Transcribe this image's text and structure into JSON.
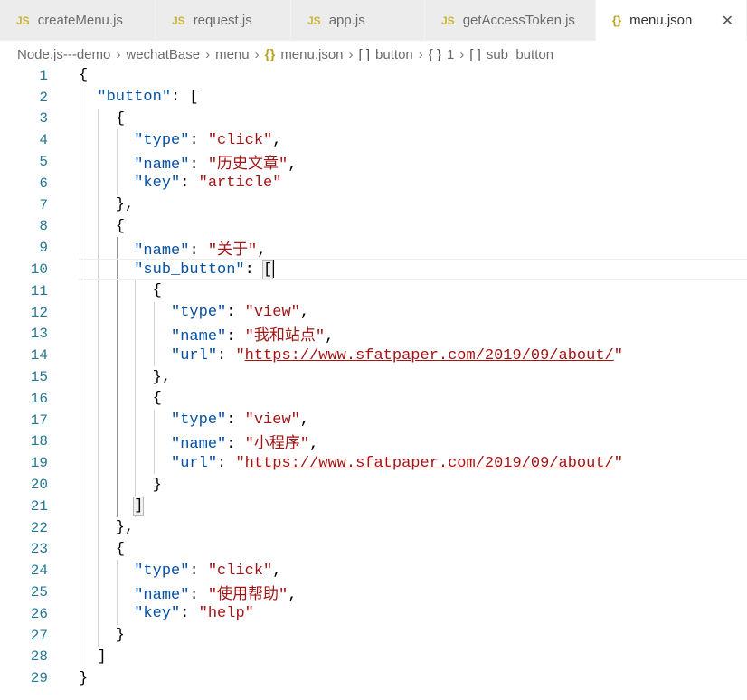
{
  "tabs": [
    {
      "icon": "JS",
      "label": "createMenu.js",
      "active": false,
      "width": 172
    },
    {
      "icon": "JS",
      "label": "request.js",
      "active": false,
      "width": 150
    },
    {
      "icon": "JS",
      "label": "app.js",
      "active": false,
      "width": 148
    },
    {
      "icon": "JS",
      "label": "getAccessToken.js",
      "active": false,
      "width": 189
    },
    {
      "icon": "{}",
      "label": "menu.json",
      "active": true,
      "width": 167
    }
  ],
  "breadcrumb": {
    "items": [
      "Node.js---demo",
      "wechatBase",
      "menu",
      "menu.json",
      "button",
      "1",
      "sub_button"
    ],
    "icons": [
      "",
      "",
      "",
      "{}",
      "[ ]",
      "{ }",
      "[ ]"
    ]
  },
  "editor": {
    "current_line": 10,
    "lines": [
      [
        [
          "p",
          "{"
        ]
      ],
      [
        [
          "p",
          "  "
        ],
        [
          "k",
          "\"button\""
        ],
        [
          "p",
          ": ["
        ]
      ],
      [
        [
          "p",
          "    {"
        ]
      ],
      [
        [
          "p",
          "      "
        ],
        [
          "k",
          "\"type\""
        ],
        [
          "p",
          ": "
        ],
        [
          "s",
          "\"click\""
        ],
        [
          "p",
          ","
        ]
      ],
      [
        [
          "p",
          "      "
        ],
        [
          "k",
          "\"name\""
        ],
        [
          "p",
          ": "
        ],
        [
          "s",
          "\"历史文章\""
        ],
        [
          "p",
          ","
        ]
      ],
      [
        [
          "p",
          "      "
        ],
        [
          "k",
          "\"key\""
        ],
        [
          "p",
          ": "
        ],
        [
          "s",
          "\"article\""
        ]
      ],
      [
        [
          "p",
          "    },"
        ]
      ],
      [
        [
          "p",
          "    {"
        ]
      ],
      [
        [
          "p",
          "      "
        ],
        [
          "k",
          "\"name\""
        ],
        [
          "p",
          ": "
        ],
        [
          "s",
          "\"关于\""
        ],
        [
          "p",
          ","
        ]
      ],
      [
        [
          "p",
          "      "
        ],
        [
          "k",
          "\"sub_button\""
        ],
        [
          "p",
          ": "
        ],
        [
          "b",
          "["
        ]
      ],
      [
        [
          "p",
          "        {"
        ]
      ],
      [
        [
          "p",
          "          "
        ],
        [
          "k",
          "\"type\""
        ],
        [
          "p",
          ": "
        ],
        [
          "s",
          "\"view\""
        ],
        [
          "p",
          ","
        ]
      ],
      [
        [
          "p",
          "          "
        ],
        [
          "k",
          "\"name\""
        ],
        [
          "p",
          ": "
        ],
        [
          "s",
          "\"我和站点\""
        ],
        [
          "p",
          ","
        ]
      ],
      [
        [
          "p",
          "          "
        ],
        [
          "k",
          "\"url\""
        ],
        [
          "p",
          ": "
        ],
        [
          "s",
          "\""
        ],
        [
          "u",
          "https://www.sfatpaper.com/2019/09/about/"
        ],
        [
          "s",
          "\""
        ]
      ],
      [
        [
          "p",
          "        },"
        ]
      ],
      [
        [
          "p",
          "        {"
        ]
      ],
      [
        [
          "p",
          "          "
        ],
        [
          "k",
          "\"type\""
        ],
        [
          "p",
          ": "
        ],
        [
          "s",
          "\"view\""
        ],
        [
          "p",
          ","
        ]
      ],
      [
        [
          "p",
          "          "
        ],
        [
          "k",
          "\"name\""
        ],
        [
          "p",
          ": "
        ],
        [
          "s",
          "\"小程序\""
        ],
        [
          "p",
          ","
        ]
      ],
      [
        [
          "p",
          "          "
        ],
        [
          "k",
          "\"url\""
        ],
        [
          "p",
          ": "
        ],
        [
          "s",
          "\""
        ],
        [
          "u",
          "https://www.sfatpaper.com/2019/09/about/"
        ],
        [
          "s",
          "\""
        ]
      ],
      [
        [
          "p",
          "        }"
        ]
      ],
      [
        [
          "p",
          "      "
        ],
        [
          "b",
          "]"
        ]
      ],
      [
        [
          "p",
          "    },"
        ]
      ],
      [
        [
          "p",
          "    {"
        ]
      ],
      [
        [
          "p",
          "      "
        ],
        [
          "k",
          "\"type\""
        ],
        [
          "p",
          ": "
        ],
        [
          "s",
          "\"click\""
        ],
        [
          "p",
          ","
        ]
      ],
      [
        [
          "p",
          "      "
        ],
        [
          "k",
          "\"name\""
        ],
        [
          "p",
          ": "
        ],
        [
          "s",
          "\"使用帮助\""
        ],
        [
          "p",
          ","
        ]
      ],
      [
        [
          "p",
          "      "
        ],
        [
          "k",
          "\"key\""
        ],
        [
          "p",
          ": "
        ],
        [
          "s",
          "\"help\""
        ]
      ],
      [
        [
          "p",
          "    }"
        ]
      ],
      [
        [
          "p",
          "  ]"
        ]
      ],
      [
        [
          "p",
          "}"
        ]
      ]
    ]
  },
  "colors": {
    "key": "#0451a5",
    "string": "#a31515",
    "line_number": "#237893",
    "js_icon": "#c9b53a"
  }
}
